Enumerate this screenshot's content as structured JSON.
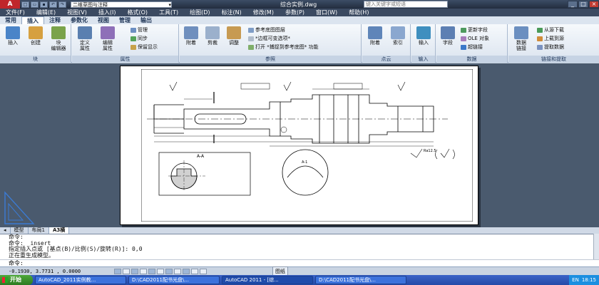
{
  "titlebar": {
    "workspace": "二维草图与注释",
    "document_title": "综合实例.dwg",
    "search_placeholder": "键入关键字或短语"
  },
  "menu": [
    "文件(F)",
    "编辑(E)",
    "视图(V)",
    "插入(I)",
    "格式(O)",
    "工具(T)",
    "绘图(D)",
    "标注(N)",
    "修改(M)",
    "参数(P)",
    "窗口(W)",
    "帮助(H)"
  ],
  "ribbon_tabs": [
    "常用",
    "插入",
    "注释",
    "参数化",
    "视图",
    "管理",
    "输出"
  ],
  "ribbon_active_tab": "插入",
  "ribbon": {
    "block_panel": {
      "title": "块",
      "insert": "插入",
      "create": "创建",
      "block_editor": "块\n编辑器"
    },
    "attributes_panel": {
      "title": "属性",
      "define": "定义\n属性",
      "edit": "编辑\n属性",
      "manage": "管理",
      "sync": "同步",
      "retain": "保留显示"
    },
    "reference_panel": {
      "title": "参照",
      "attach": "附着",
      "clip": "剪裁",
      "adjust": "调整",
      "ref_layer": "参考底图图层",
      "frame": "*边框可变选项*",
      "snap": "打开 *捕捉到参考底图* 功能"
    },
    "pointcloud_panel": {
      "title": "点云",
      "attach": "附着",
      "index": "索引"
    },
    "import_panel": {
      "title": "输入",
      "import": "输入"
    },
    "data_panel": {
      "title": "数据",
      "field": "字段",
      "update_fields": "更新字段",
      "ole": "OLE 对象",
      "hyperlink": "超链接"
    },
    "link_panel": {
      "title": "链接和提取",
      "data_link": "数据\n链接",
      "download": "从源下载",
      "upload": "上载到源",
      "extract": "提取数据"
    }
  },
  "layout_tabs": [
    "模型",
    "布局1",
    "A3横"
  ],
  "active_layout": "A3横",
  "command_history": [
    "命令:",
    "命令: _insert",
    "指定插入点或 [基点(B)/比例(S)/旋转(R)]: 0,0",
    "正在重生成模型。"
  ],
  "command_prompt": "命令:",
  "status": {
    "coordinates": "-0.1930,  3.7731 ,  0.0000",
    "paper_label": "图纸"
  },
  "taskbar": {
    "start": "开始",
    "items": [
      "AutoCAD_2011实例教...",
      "D:\\CAD2011配书光盘\\...",
      "AutoCAD 2011 - [综...",
      "D:\\CAD2011配书光盘\\..."
    ],
    "clock": "18:15",
    "lang": "EN"
  },
  "drawing": {
    "section_label": "A-A",
    "detail_label": "A-1",
    "surface_symbol": "Ra12.5"
  },
  "colors": {
    "accent": "#c0262b",
    "titlebar": "#2e3b50",
    "workspace_bg": "#4a5a6e"
  }
}
